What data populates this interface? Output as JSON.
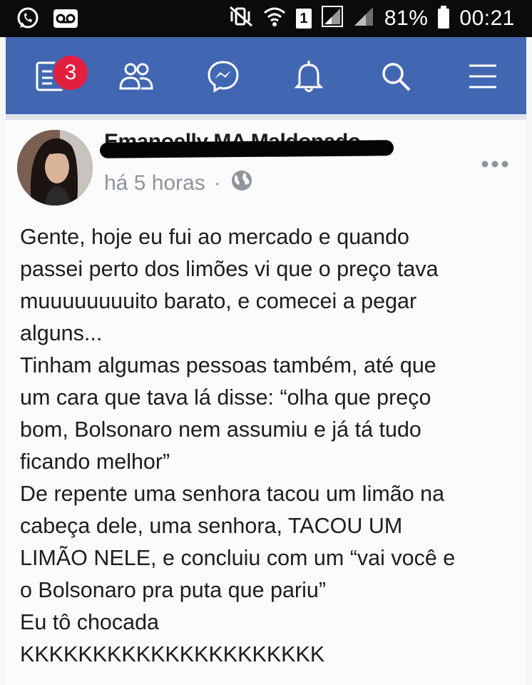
{
  "status_bar": {
    "icons_left": [
      "whatsapp-icon",
      "voicemail-icon"
    ],
    "icons_right": [
      "mute-vibrate-icon",
      "wifi-icon",
      "sim-1-badge",
      "signal-icon",
      "signal-icon",
      "battery-icon"
    ],
    "sim_label": "1",
    "battery_percent": "81%",
    "time": "00:21"
  },
  "nav_bar": {
    "icons": [
      "news-feed-icon",
      "friends-icon",
      "messenger-icon",
      "notifications-icon",
      "search-icon",
      "menu-icon"
    ],
    "notification_count": "3",
    "colors": {
      "bar": "#4267b2",
      "badge": "#e41e3f"
    }
  },
  "post": {
    "author": "Emanoelly MA Maldonado",
    "time_ago": "há 5 horas",
    "separator": "·",
    "privacy_icon": "globe-icon",
    "more_icon": "more-options-icon",
    "lines": [
      "Gente, hoje eu fui ao mercado e quando",
      "passei perto dos limões vi que o preço tava",
      "muuuuuuuuito barato, e comecei a pegar",
      "alguns...",
      "Tinham algumas pessoas também, até que",
      "um cara que tava lá disse: “olha que preço",
      "bom, Bolsonaro nem assumiu e já tá tudo",
      "ficando melhor”",
      "De repente uma senhora tacou um limão na",
      "cabeça dele, uma senhora, TACOU UM",
      "LIMÃO NELE, e concluiu com um “vai você e",
      "o Bolsonaro pra puta que pariu”",
      "Eu tô chocada",
      "KKKKKKKKKKKKKKKKKKKKK"
    ]
  }
}
